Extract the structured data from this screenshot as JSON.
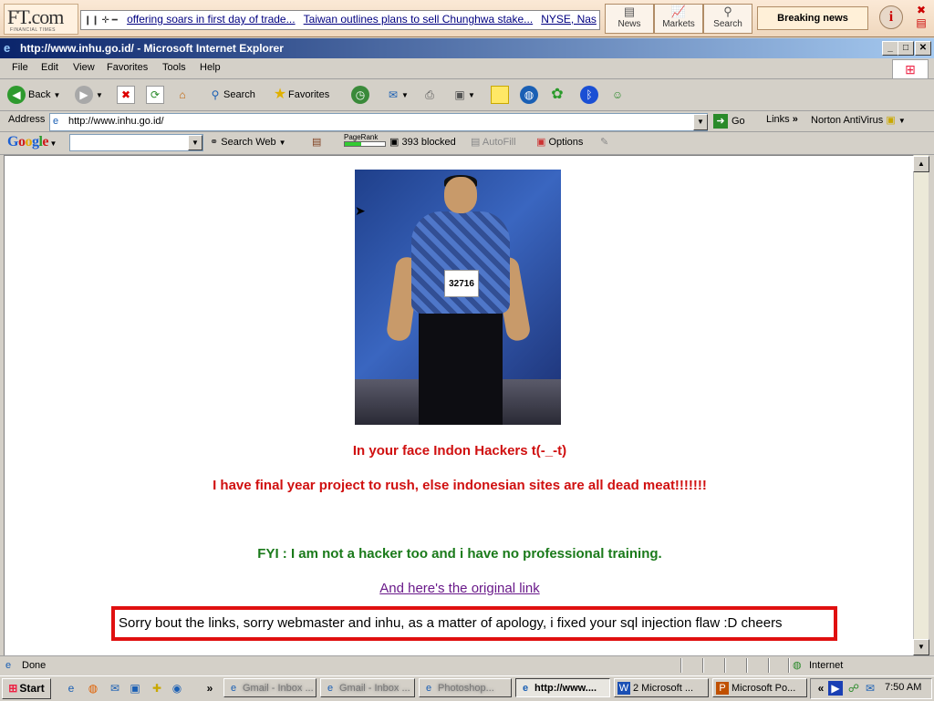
{
  "ft_toolbar": {
    "logo": "FT.com",
    "logo_sub": "FINANCIAL TIMES",
    "ticker_items": [
      "offering soars in first day of trade...",
      "Taiwan outlines plans to sell Chunghwa stake...",
      "NYSE, Nas"
    ],
    "buttons": [
      {
        "label": "News"
      },
      {
        "label": "Markets"
      },
      {
        "label": "Search"
      }
    ],
    "breaking_news": "Breaking news",
    "info_icon": "i"
  },
  "window": {
    "title": "http://www.inhu.go.id/ - Microsoft Internet Explorer"
  },
  "menu": {
    "items": [
      "File",
      "Edit",
      "View",
      "Favorites",
      "Tools",
      "Help"
    ]
  },
  "toolbar": {
    "back_label": "Back",
    "search_label": "Search",
    "favorites_label": "Favorites"
  },
  "address": {
    "label": "Address",
    "value": "http://www.inhu.go.id/",
    "go_label": "Go",
    "links_label": "Links",
    "norton_label": "Norton AntiVirus"
  },
  "google_toolbar": {
    "logo": "Google",
    "search_web": "Search Web",
    "pagerank_label": "PageRank",
    "blocked": "393 blocked",
    "autofill": "AutoFill",
    "options": "Options"
  },
  "page": {
    "photo_tag": "32716",
    "line1": "In your face Indon Hackers t(-_-t)",
    "line2": "I have final year project to rush, else indonesian sites are all dead meat!!!!!!!",
    "line3": "FYI : I am not a hacker too and i have no professional training.",
    "link": "And here's the original link",
    "apology": "Sorry bout the links, sorry webmaster and inhu, as a matter of apology, i fixed your sql injection flaw :D cheers"
  },
  "status": {
    "text": "Done",
    "zone": "Internet"
  },
  "taskbar": {
    "start": "Start",
    "tasks": [
      {
        "label": "Gmail - Inbox ..."
      },
      {
        "label": "Gmail - Inbox ..."
      },
      {
        "label": "Photoshop..."
      },
      {
        "label": "http://www...."
      },
      {
        "label": "2 Microsoft ..."
      },
      {
        "label": "Microsoft Po..."
      }
    ],
    "clock": "7:50 AM"
  },
  "colors": {
    "headline_red": "#d01010",
    "fyi_green": "#1a7a1a",
    "link_purple": "#6a1a8a",
    "apology_border": "#e01010",
    "titlebar": "#0a246a"
  }
}
